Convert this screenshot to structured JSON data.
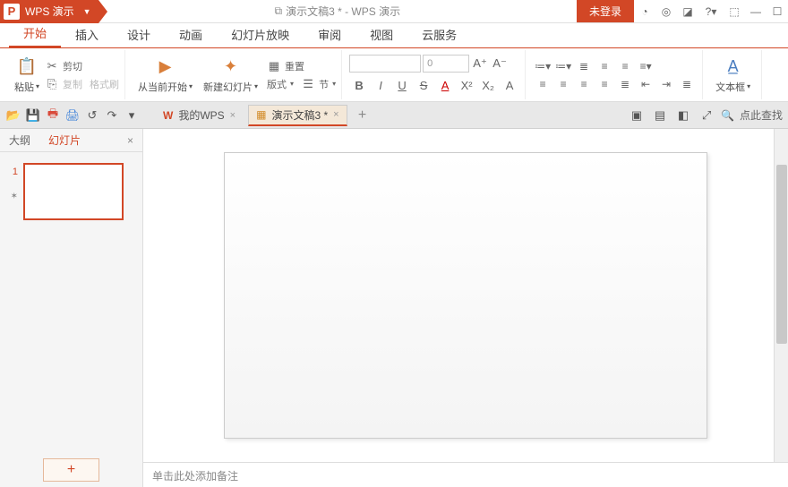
{
  "app": {
    "name": "WPS 演示",
    "logo_glyph": "P"
  },
  "title": {
    "doc_icon": "⧉",
    "text": "演示文稿3 * - WPS 演示"
  },
  "login": {
    "label": "未登录"
  },
  "sysicons": [
    "◔",
    "◎",
    "◪",
    "?▾",
    "⬚",
    "—",
    "☐"
  ],
  "menutabs": [
    "开始",
    "插入",
    "设计",
    "动画",
    "幻灯片放映",
    "审阅",
    "视图",
    "云服务"
  ],
  "ribbon": {
    "paste": {
      "label": "粘贴",
      "cut": "剪切",
      "copy": "复制",
      "format_painter": "格式刷"
    },
    "slides": {
      "from_current": "从当前开始",
      "new_slide": "新建幻灯片",
      "layout": "版式",
      "section": "节",
      "reset": "重置"
    },
    "font": {
      "size_placeholder": "0",
      "A_inc": "A⁺",
      "A_dec": "A⁻",
      "fmt": [
        "B",
        "I",
        "U",
        "S",
        "A",
        "X²",
        "X₂",
        "A"
      ]
    },
    "para_top": [
      "≔▾",
      "≔▾",
      "≣",
      "≡",
      "≡",
      "≡▾"
    ],
    "para_bottom": [
      "≡",
      "≡",
      "≡",
      "≡",
      "≣",
      "⇤",
      "⇥",
      "≣"
    ],
    "textbox": {
      "label": "文本框"
    }
  },
  "qat": [
    "📂",
    "💾",
    "🖶",
    "🖨",
    "↺",
    "↷",
    "▾"
  ],
  "doc_tabs": [
    {
      "icon": "W",
      "label": "我的WPS",
      "closable": true,
      "active": false,
      "icon_color": "#d24726"
    },
    {
      "icon": "▦",
      "label": "演示文稿3 *",
      "closable": true,
      "active": true,
      "icon_color": "#d28a26"
    }
  ],
  "add_tab": "+",
  "qat_right": {
    "icons": [
      "▣",
      "▤",
      "◧",
      "⤢"
    ],
    "search_icon": "🔍",
    "search_text": "点此查找"
  },
  "sidebar": {
    "tabs": [
      "大纲",
      "幻灯片"
    ],
    "close": "×",
    "slide_numbers": [
      "1"
    ],
    "star": "✶",
    "add": "+"
  },
  "notes": {
    "placeholder": "单击此处添加备注"
  }
}
